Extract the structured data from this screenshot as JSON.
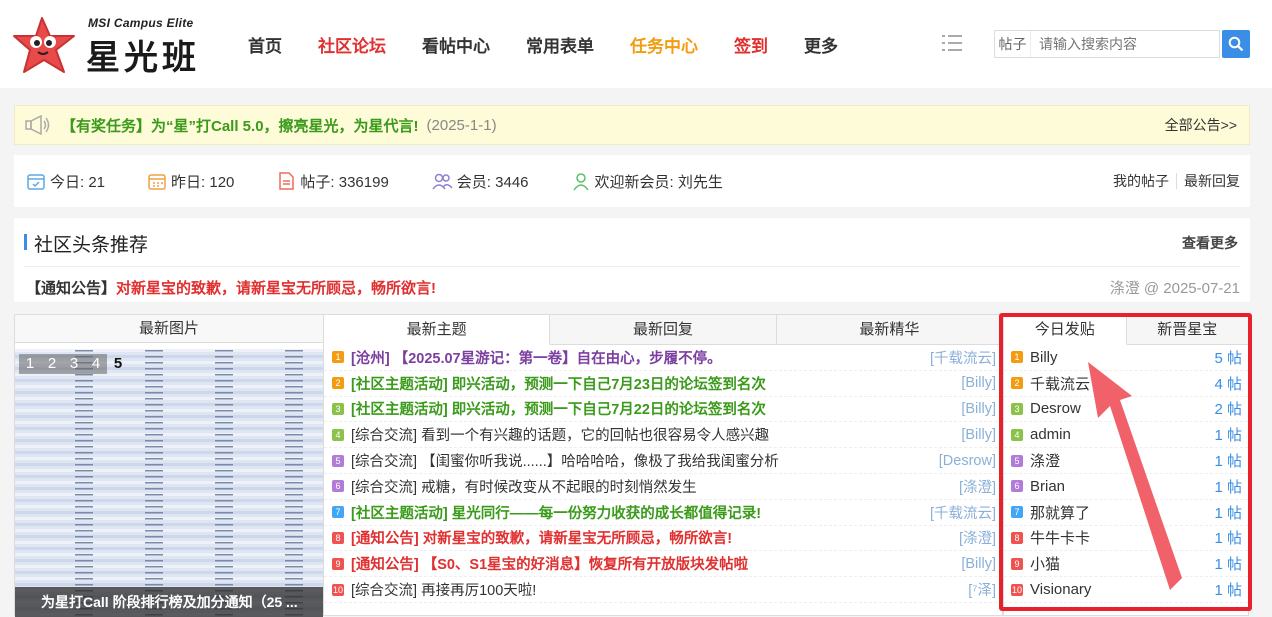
{
  "logo": {
    "small": "MSI Campus Elite",
    "big": "星光班"
  },
  "nav": [
    "首页",
    "社区论坛",
    "看帖中心",
    "常用表单",
    "任务中心",
    "签到",
    "更多"
  ],
  "search": {
    "type": "帖子",
    "placeholder": "请输入搜索内容"
  },
  "notice": {
    "text": "【有奖任务】为“星”打Call 5.0，擦亮星光，为星代言!",
    "date": "(2025-1-1)",
    "all": "全部公告>>"
  },
  "stats": {
    "today": "今日: 21",
    "yesterday": "昨日: 120",
    "posts": "帖子: 336199",
    "members": "会员: 3446",
    "newmember": "欢迎新会员: 刘先生",
    "myposts": "我的帖子",
    "latest_reply": "最新回复"
  },
  "headline": {
    "title": "社区头条推荐",
    "more": "查看更多",
    "tag": "【通知公告】",
    "text": "对新星宝的致歉，请新星宝无所顾忌，畅所欲言!",
    "meta": "涤澄 @ 2025-07-21"
  },
  "pics": {
    "tab": "最新图片",
    "pages": [
      "1",
      "2",
      "3",
      "4",
      "5"
    ],
    "caption": "为星打Call 阶段排行榜及加分通知（25 ..."
  },
  "topic_tabs": [
    "最新主题",
    "最新回复",
    "最新精华"
  ],
  "topics": [
    {
      "n": "1",
      "cat": "[沧州]",
      "title": " 【2025.07星游记：第一卷】自在由心，步履不停。",
      "style": "c-purple",
      "catstyle": "c-purple",
      "author": "[千载流云]"
    },
    {
      "n": "2",
      "cat": "[社区主题活动]",
      "title": " 即兴活动，预测一下自己7月23日的论坛签到名次",
      "style": "c-green",
      "catstyle": "c-green",
      "author": "[Billy]"
    },
    {
      "n": "3",
      "cat": "[社区主题活动]",
      "title": " 即兴活动，预测一下自己7月22日的论坛签到名次",
      "style": "c-green",
      "catstyle": "c-green",
      "author": "[Billy]"
    },
    {
      "n": "4",
      "cat": "[综合交流]",
      "title": " 看到一个有兴趣的话题，它的回帖也很容易令人感兴趣",
      "style": "c-normal",
      "catstyle": "c-normal",
      "author": "[Billy]"
    },
    {
      "n": "5",
      "cat": "[综合交流]",
      "title": " 【闺蜜你听我说......】哈哈哈哈，像极了我给我闺蜜分析",
      "style": "c-normal",
      "catstyle": "c-normal",
      "author": "[Desrow]"
    },
    {
      "n": "6",
      "cat": "[综合交流]",
      "title": " 戒糖，有时候改变从不起眼的时刻悄然发生",
      "style": "c-normal",
      "catstyle": "c-normal",
      "author": "[涤澄]"
    },
    {
      "n": "7",
      "cat": "[社区主题活动]",
      "title": " 星光同行——每一份努力收获的成长都值得记录!",
      "style": "c-green",
      "catstyle": "c-green",
      "author": "[千载流云]"
    },
    {
      "n": "8",
      "cat": "[通知公告]",
      "title": " 对新星宝的致歉，请新星宝无所顾忌，畅所欲言!",
      "style": "c-red",
      "catstyle": "c-red",
      "author": "[涤澄]"
    },
    {
      "n": "9",
      "cat": "[通知公告]",
      "title": " 【S0、S1星宝的好消息】恢复所有开放版块发帖啦",
      "style": "c-red",
      "catstyle": "c-red",
      "author": "[Billy]"
    },
    {
      "n": "10",
      "cat": "[综合交流]",
      "title": " 再接再厉100天啦!",
      "style": "c-normal",
      "catstyle": "c-normal",
      "author": "[⁷泽]"
    }
  ],
  "rank_tabs": [
    "今日发贴",
    "新晋星宝"
  ],
  "ranks": [
    {
      "n": "1",
      "name": "Billy",
      "count": "5 帖"
    },
    {
      "n": "2",
      "name": "千载流云",
      "count": "4 帖"
    },
    {
      "n": "3",
      "name": "Desrow",
      "count": "2 帖"
    },
    {
      "n": "4",
      "name": "admin",
      "count": "1 帖"
    },
    {
      "n": "5",
      "name": "涤澄",
      "count": "1 帖"
    },
    {
      "n": "6",
      "name": "Brian",
      "count": "1 帖"
    },
    {
      "n": "7",
      "name": "那就算了",
      "count": "1 帖"
    },
    {
      "n": "8",
      "name": "牛牛卡卡",
      "count": "1 帖"
    },
    {
      "n": "9",
      "name": "小猫",
      "count": "1 帖"
    },
    {
      "n": "10",
      "name": "Visionary",
      "count": "1 帖"
    }
  ],
  "num_colors": [
    "#f39c12",
    "#f39c12",
    "#8bc34a",
    "#8bc34a",
    "#b07cd8",
    "#b07cd8",
    "#42a5f5",
    "#ef5350",
    "#ef5350",
    "#ef5350"
  ],
  "accent": "#3a8ee6",
  "highlight": "#e8202a"
}
